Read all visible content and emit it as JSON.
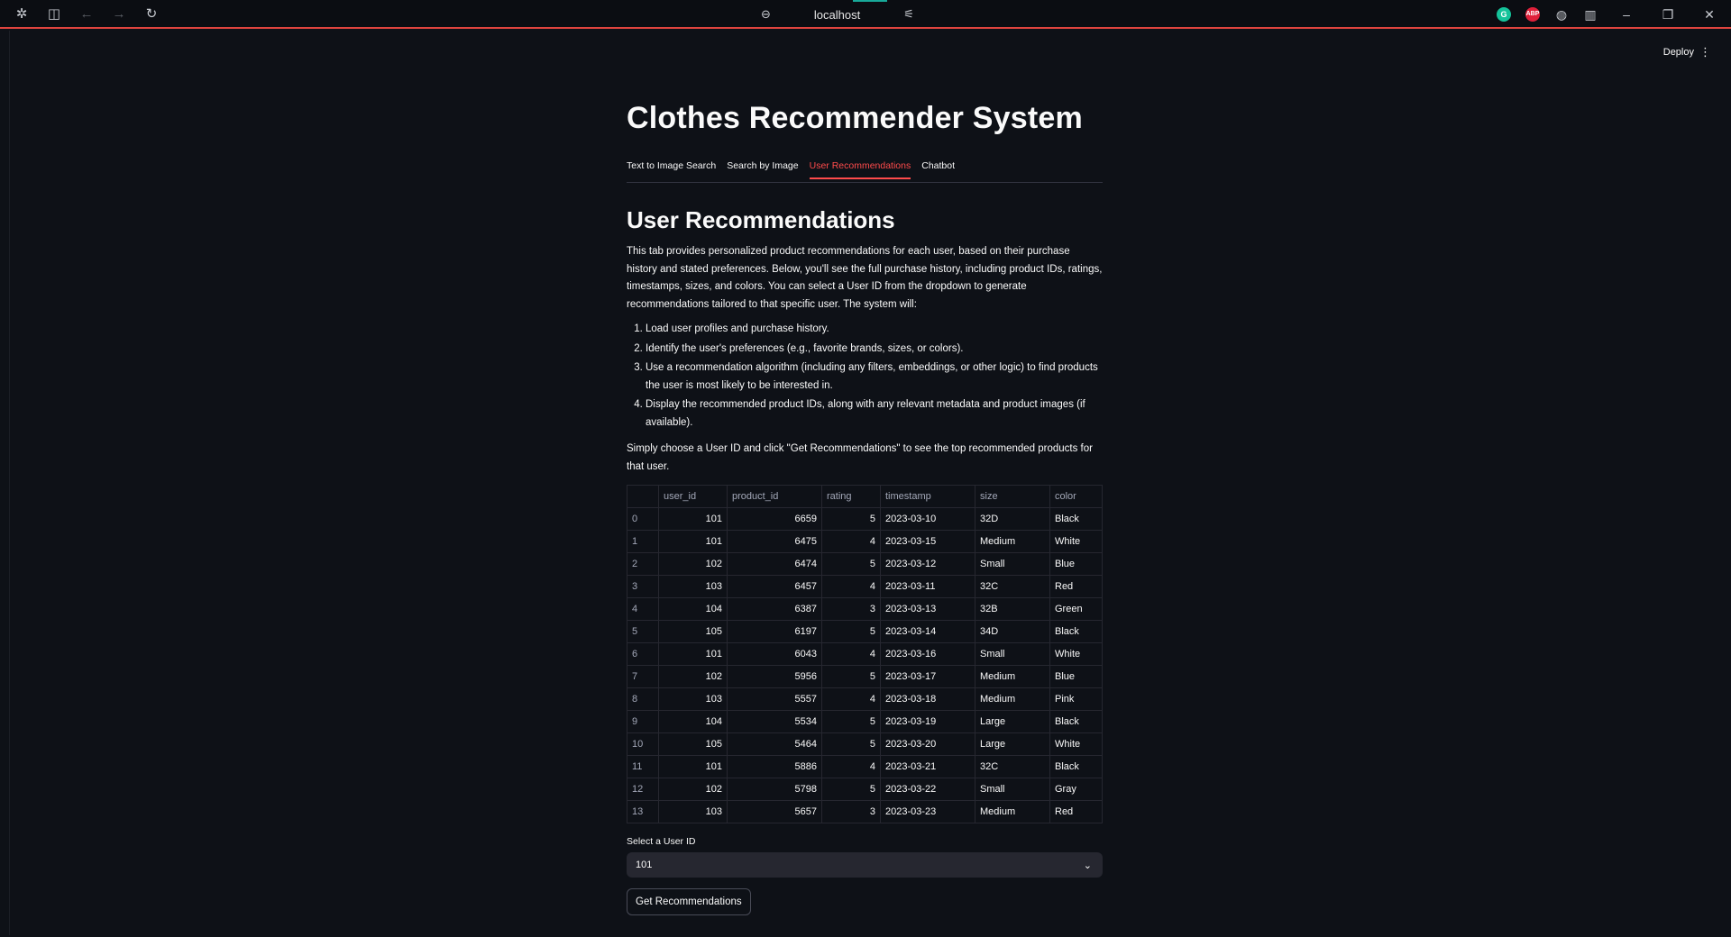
{
  "browser": {
    "url": "localhost",
    "extensions": [
      "G",
      "ABP"
    ]
  },
  "app": {
    "deploy_label": "Deploy",
    "title": "Clothes Recommender System",
    "tabs": [
      {
        "label": "Text to Image Search",
        "active": false
      },
      {
        "label": "Search by Image",
        "active": false
      },
      {
        "label": "User Recommendations",
        "active": true
      },
      {
        "label": "Chatbot",
        "active": false
      }
    ],
    "section_title": "User Recommendations",
    "intro": "This tab provides personalized product recommendations for each user, based on their purchase history and stated preferences. Below, you'll see the full purchase history, including product IDs, ratings, timestamps, sizes, and colors. You can select a User ID from the dropdown to generate recommendations tailored to that specific user. The system will:",
    "steps": [
      "Load user profiles and purchase history.",
      "Identify the user's preferences (e.g., favorite brands, sizes, or colors).",
      "Use a recommendation algorithm (including any filters, embeddings, or other logic) to find products the user is most likely to be interested in.",
      "Display the recommended product IDs, along with any relevant metadata and product images (if available)."
    ],
    "instruction": "Simply choose a User ID and click \"Get Recommendations\" to see the top recommended products for that user.",
    "table": {
      "columns": [
        "",
        "user_id",
        "product_id",
        "rating",
        "timestamp",
        "size",
        "color"
      ],
      "rows": [
        [
          "0",
          "101",
          "6659",
          "5",
          "2023-03-10",
          "32D",
          "Black"
        ],
        [
          "1",
          "101",
          "6475",
          "4",
          "2023-03-15",
          "Medium",
          "White"
        ],
        [
          "2",
          "102",
          "6474",
          "5",
          "2023-03-12",
          "Small",
          "Blue"
        ],
        [
          "3",
          "103",
          "6457",
          "4",
          "2023-03-11",
          "32C",
          "Red"
        ],
        [
          "4",
          "104",
          "6387",
          "3",
          "2023-03-13",
          "32B",
          "Green"
        ],
        [
          "5",
          "105",
          "6197",
          "5",
          "2023-03-14",
          "34D",
          "Black"
        ],
        [
          "6",
          "101",
          "6043",
          "4",
          "2023-03-16",
          "Small",
          "White"
        ],
        [
          "7",
          "102",
          "5956",
          "5",
          "2023-03-17",
          "Medium",
          "Blue"
        ],
        [
          "8",
          "103",
          "5557",
          "4",
          "2023-03-18",
          "Medium",
          "Pink"
        ],
        [
          "9",
          "104",
          "5534",
          "5",
          "2023-03-19",
          "Large",
          "Black"
        ],
        [
          "10",
          "105",
          "5464",
          "5",
          "2023-03-20",
          "Large",
          "White"
        ],
        [
          "11",
          "101",
          "5886",
          "4",
          "2023-03-21",
          "32C",
          "Black"
        ],
        [
          "12",
          "102",
          "5798",
          "5",
          "2023-03-22",
          "Small",
          "Gray"
        ],
        [
          "13",
          "103",
          "5657",
          "3",
          "2023-03-23",
          "Medium",
          "Red"
        ]
      ]
    },
    "select_label": "Select a User ID",
    "select_value": "101",
    "button_label": "Get Recommendations"
  },
  "colors": {
    "background": "#0e1117",
    "accent": "#ff4b4b",
    "text": "#fafafa",
    "muted": "#a3a8b8"
  }
}
